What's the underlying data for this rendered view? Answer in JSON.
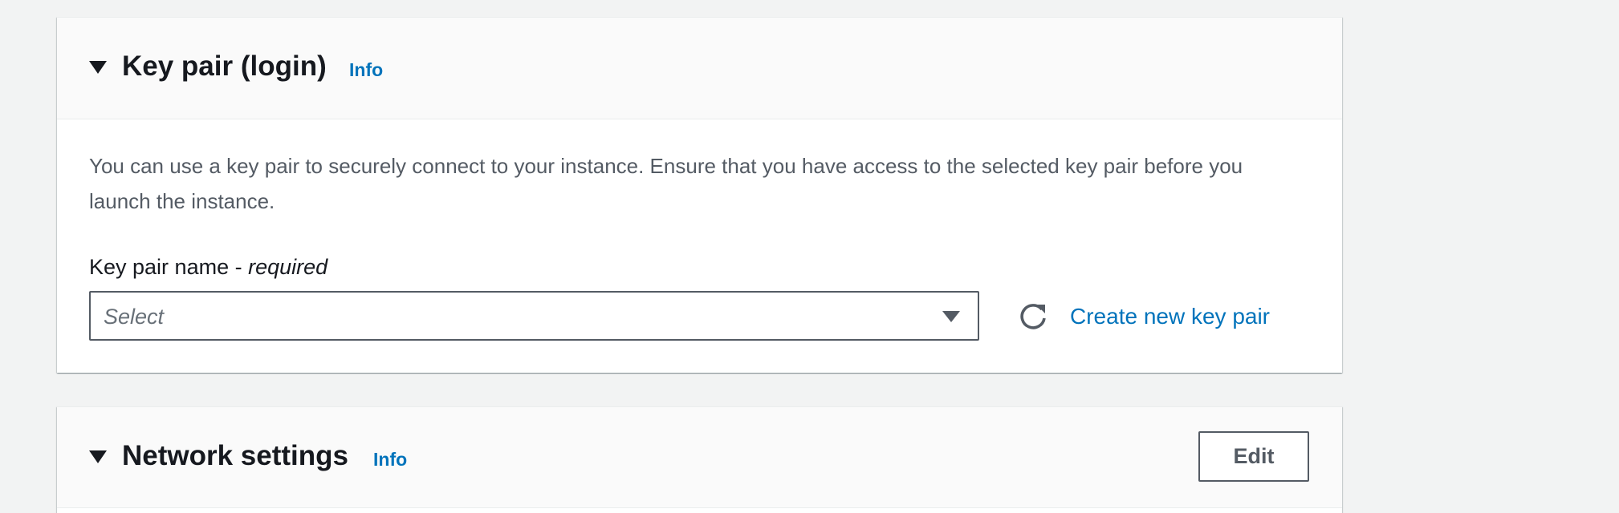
{
  "key_pair_section": {
    "title": "Key pair (login)",
    "info_label": "Info",
    "description": "You can use a key pair to securely connect to your instance. Ensure that you have access to the selected key pair before you launch the instance.",
    "field_label": "Key pair name - ",
    "field_required": "required",
    "select_placeholder": "Select",
    "refresh_icon": "refresh-icon",
    "create_link": "Create new key pair"
  },
  "network_section": {
    "title": "Network settings",
    "info_label": "Info",
    "edit_label": "Edit"
  },
  "colors": {
    "background": "#f2f3f3",
    "panel": "#ffffff",
    "header": "#fafafa",
    "link": "#0073bb",
    "text": "#16191f",
    "muted": "#545b64"
  }
}
